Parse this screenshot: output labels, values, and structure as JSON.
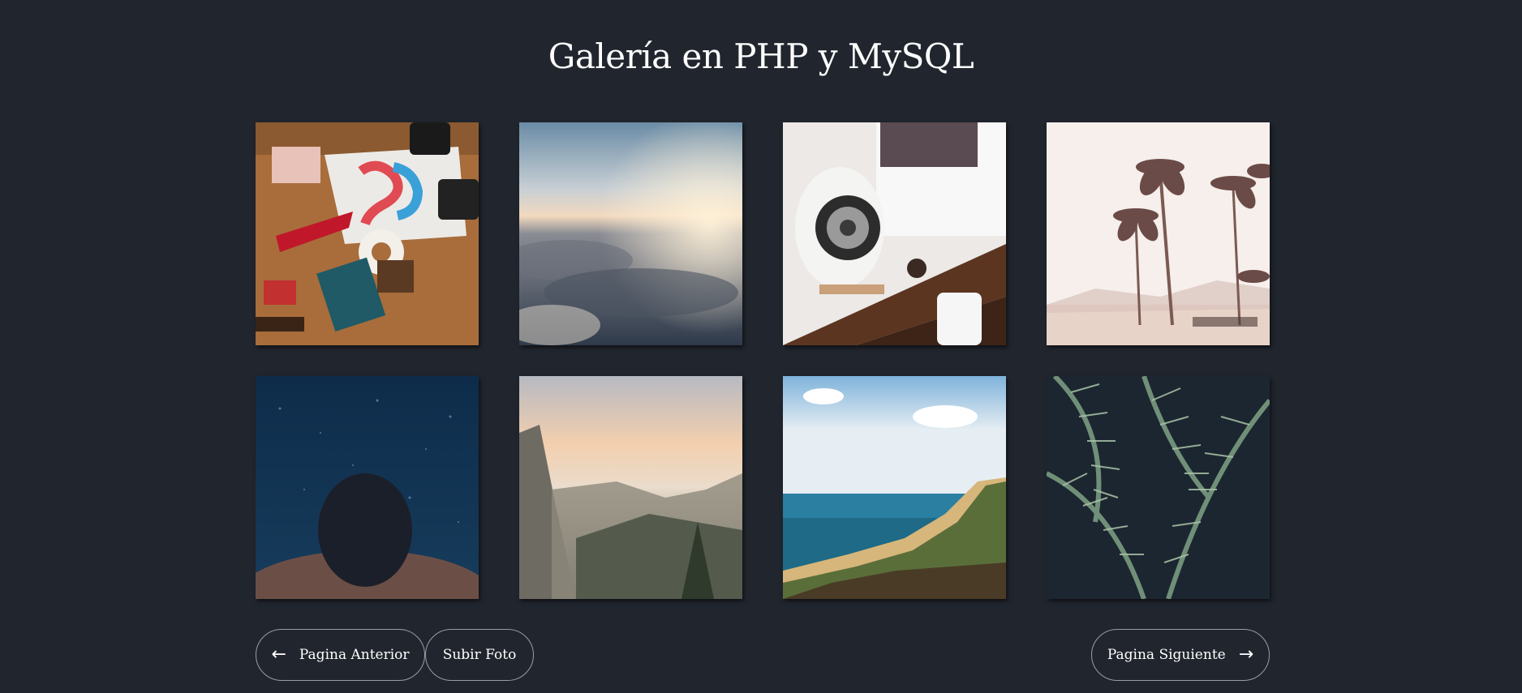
{
  "header": {
    "title": "Galería en PHP y MySQL"
  },
  "gallery": {
    "photos": [
      {
        "subject": "flat lay desk with t-shirt, camera and pennant",
        "dominant_color": "#9a6a3e"
      },
      {
        "subject": "sea of clouds at sunrise",
        "dominant_color": "#6f7a86"
      },
      {
        "subject": "workspace with white speaker and monitor",
        "dominant_color": "#d8d6d3"
      },
      {
        "subject": "palm trees on hazy beach",
        "dominant_color": "#f1e7e2"
      },
      {
        "subject": "person submerged underwater",
        "dominant_color": "#123655"
      },
      {
        "subject": "mountain valley cliffs at sunset",
        "dominant_color": "#9f8d7e"
      },
      {
        "subject": "coastline with beach and ocean",
        "dominant_color": "#2b6f86"
      },
      {
        "subject": "green fern leaves",
        "dominant_color": "#3f5b4a"
      }
    ]
  },
  "pagination": {
    "prev_label": "Pagina Anterior",
    "upload_label": "Subir Foto",
    "next_label": "Pagina Siguiente"
  },
  "icons": {
    "prev": "arrow-left-icon",
    "next": "arrow-right-icon"
  },
  "colors": {
    "background": "#21262e",
    "text": "#ffffff",
    "button_border": "#bfc2c6"
  }
}
